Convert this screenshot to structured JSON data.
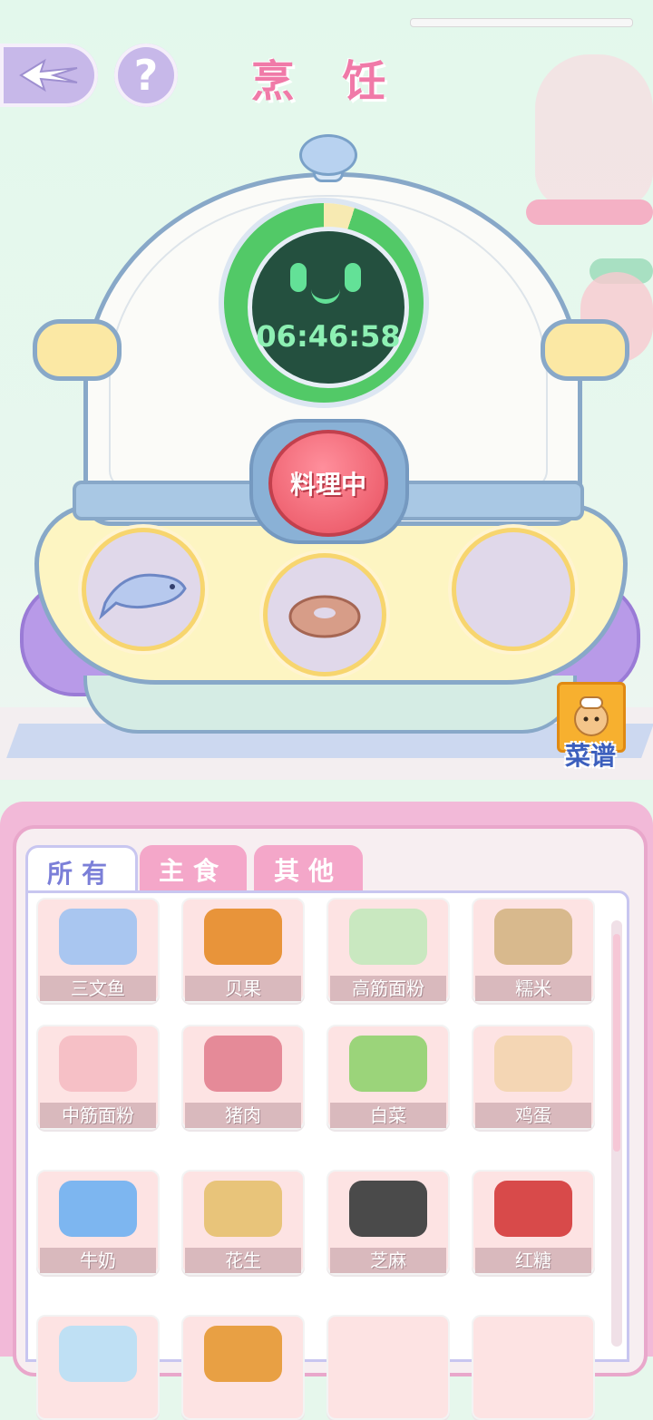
{
  "header": {
    "title": "烹 饪",
    "back_icon": "wing-back-icon",
    "help_label": "?"
  },
  "cooker": {
    "timer": "06:46:58",
    "timer_progress": 0.95,
    "status_button": "料理中",
    "slots": [
      {
        "icon": "salmon-icon",
        "filled": true
      },
      {
        "icon": "bagel-icon",
        "filled": true
      },
      {
        "icon": "empty-slot",
        "filled": false
      }
    ]
  },
  "recipe": {
    "label": "菜谱",
    "icon": "hamster-chef-book-icon"
  },
  "tabs": [
    {
      "label": "所有",
      "active": true
    },
    {
      "label": "主食",
      "active": false
    },
    {
      "label": "其他",
      "active": false
    }
  ],
  "ingredients": [
    {
      "name": "三文鱼",
      "icon": "salmon-icon",
      "color": "#a9c6f0"
    },
    {
      "name": "贝果",
      "icon": "bagel-icon",
      "color": "#e8943a"
    },
    {
      "name": "高筋面粉",
      "icon": "flour-bag-green-icon",
      "color": "#c9e8c0"
    },
    {
      "name": "糯米",
      "icon": "rice-sack-icon",
      "color": "#d8b98d"
    },
    {
      "name": "中筋面粉",
      "icon": "flour-bag-pink-icon",
      "color": "#f6c0c6"
    },
    {
      "name": "猪肉",
      "icon": "pork-icon",
      "color": "#e58a98"
    },
    {
      "name": "白菜",
      "icon": "cabbage-icon",
      "color": "#9bd47a"
    },
    {
      "name": "鸡蛋",
      "icon": "egg-carton-icon",
      "color": "#f4d6b4"
    },
    {
      "name": "牛奶",
      "icon": "milk-carton-icon",
      "color": "#7db6f0"
    },
    {
      "name": "花生",
      "icon": "peanut-bag-icon",
      "color": "#e8c47a"
    },
    {
      "name": "芝麻",
      "icon": "sesame-sack-icon",
      "color": "#4a4a4a"
    },
    {
      "name": "红糖",
      "icon": "brown-sugar-bag-icon",
      "color": "#d84a4a"
    },
    {
      "name": "",
      "icon": "water-bottle-icon",
      "color": "#bfe0f4"
    },
    {
      "name": "",
      "icon": "bread-icon",
      "color": "#e8a044"
    },
    {
      "name": "",
      "icon": "item-icon",
      "color": "#fde3e3"
    },
    {
      "name": "",
      "icon": "item-icon",
      "color": "#fde3e3"
    }
  ]
}
